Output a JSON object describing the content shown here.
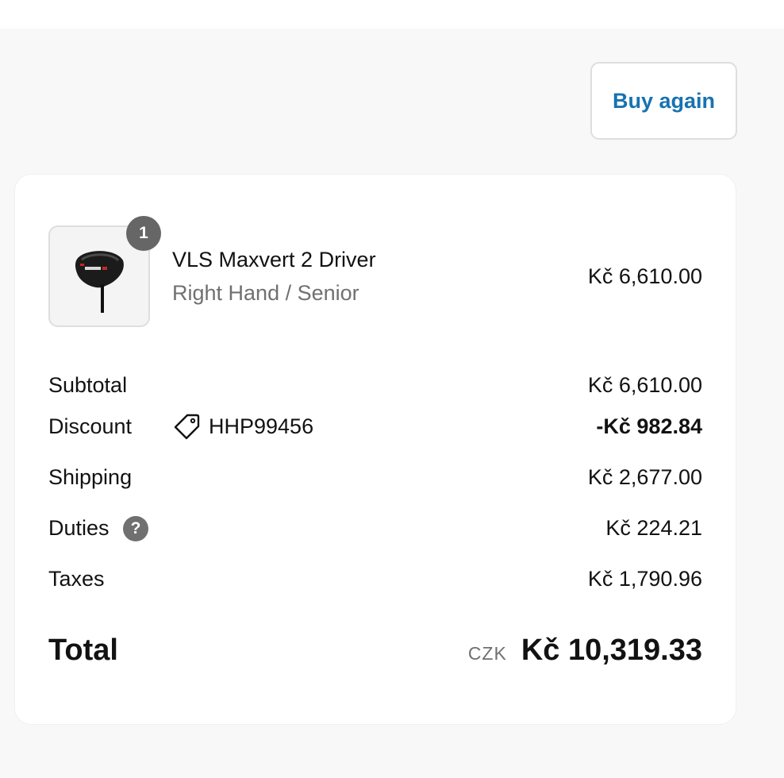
{
  "actions": {
    "buy_again_label": "Buy again"
  },
  "product": {
    "quantity": "1",
    "name": "VLS Maxvert 2 Driver",
    "variant": "Right Hand / Senior",
    "price": "Kč 6,610.00",
    "thumbnail_icon": "golf-driver-icon"
  },
  "summary": {
    "subtotal": {
      "label": "Subtotal",
      "value": "Kč 6,610.00"
    },
    "discount": {
      "label": "Discount",
      "code": "HHP99456",
      "code_icon": "tag-icon",
      "value": "-Kč 982.84"
    },
    "shipping": {
      "label": "Shipping",
      "value": "Kč 2,677.00"
    },
    "duties": {
      "label": "Duties",
      "help_icon": "question-icon",
      "help_glyph": "?",
      "value": "Kč 224.21"
    },
    "taxes": {
      "label": "Taxes",
      "value": "Kč 1,790.96"
    }
  },
  "total": {
    "label": "Total",
    "currency": "CZK",
    "value": "Kč 10,319.33"
  },
  "colors": {
    "accent": "#1773b0",
    "page_background": "#f8f8f8",
    "badge": "#666666",
    "muted_text": "#707070"
  }
}
